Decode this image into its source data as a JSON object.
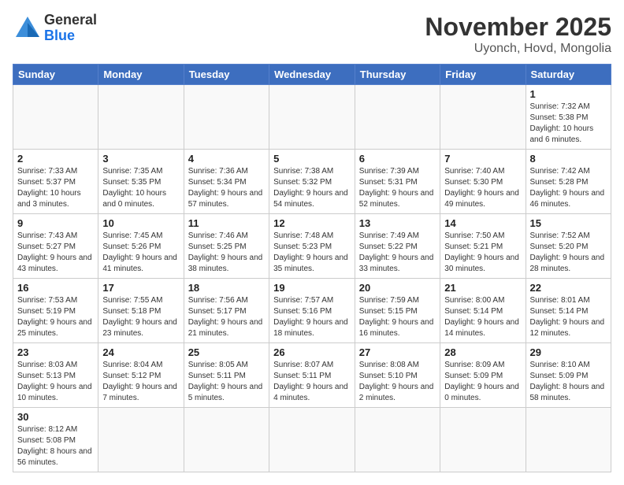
{
  "header": {
    "logo_general": "General",
    "logo_blue": "Blue",
    "month_title": "November 2025",
    "subtitle": "Uyonch, Hovd, Mongolia"
  },
  "days_of_week": [
    "Sunday",
    "Monday",
    "Tuesday",
    "Wednesday",
    "Thursday",
    "Friday",
    "Saturday"
  ],
  "weeks": [
    [
      {
        "day": "",
        "info": ""
      },
      {
        "day": "",
        "info": ""
      },
      {
        "day": "",
        "info": ""
      },
      {
        "day": "",
        "info": ""
      },
      {
        "day": "",
        "info": ""
      },
      {
        "day": "",
        "info": ""
      },
      {
        "day": "1",
        "info": "Sunrise: 7:32 AM\nSunset: 5:38 PM\nDaylight: 10 hours and 6 minutes."
      }
    ],
    [
      {
        "day": "2",
        "info": "Sunrise: 7:33 AM\nSunset: 5:37 PM\nDaylight: 10 hours and 3 minutes."
      },
      {
        "day": "3",
        "info": "Sunrise: 7:35 AM\nSunset: 5:35 PM\nDaylight: 10 hours and 0 minutes."
      },
      {
        "day": "4",
        "info": "Sunrise: 7:36 AM\nSunset: 5:34 PM\nDaylight: 9 hours and 57 minutes."
      },
      {
        "day": "5",
        "info": "Sunrise: 7:38 AM\nSunset: 5:32 PM\nDaylight: 9 hours and 54 minutes."
      },
      {
        "day": "6",
        "info": "Sunrise: 7:39 AM\nSunset: 5:31 PM\nDaylight: 9 hours and 52 minutes."
      },
      {
        "day": "7",
        "info": "Sunrise: 7:40 AM\nSunset: 5:30 PM\nDaylight: 9 hours and 49 minutes."
      },
      {
        "day": "8",
        "info": "Sunrise: 7:42 AM\nSunset: 5:28 PM\nDaylight: 9 hours and 46 minutes."
      }
    ],
    [
      {
        "day": "9",
        "info": "Sunrise: 7:43 AM\nSunset: 5:27 PM\nDaylight: 9 hours and 43 minutes."
      },
      {
        "day": "10",
        "info": "Sunrise: 7:45 AM\nSunset: 5:26 PM\nDaylight: 9 hours and 41 minutes."
      },
      {
        "day": "11",
        "info": "Sunrise: 7:46 AM\nSunset: 5:25 PM\nDaylight: 9 hours and 38 minutes."
      },
      {
        "day": "12",
        "info": "Sunrise: 7:48 AM\nSunset: 5:23 PM\nDaylight: 9 hours and 35 minutes."
      },
      {
        "day": "13",
        "info": "Sunrise: 7:49 AM\nSunset: 5:22 PM\nDaylight: 9 hours and 33 minutes."
      },
      {
        "day": "14",
        "info": "Sunrise: 7:50 AM\nSunset: 5:21 PM\nDaylight: 9 hours and 30 minutes."
      },
      {
        "day": "15",
        "info": "Sunrise: 7:52 AM\nSunset: 5:20 PM\nDaylight: 9 hours and 28 minutes."
      }
    ],
    [
      {
        "day": "16",
        "info": "Sunrise: 7:53 AM\nSunset: 5:19 PM\nDaylight: 9 hours and 25 minutes."
      },
      {
        "day": "17",
        "info": "Sunrise: 7:55 AM\nSunset: 5:18 PM\nDaylight: 9 hours and 23 minutes."
      },
      {
        "day": "18",
        "info": "Sunrise: 7:56 AM\nSunset: 5:17 PM\nDaylight: 9 hours and 21 minutes."
      },
      {
        "day": "19",
        "info": "Sunrise: 7:57 AM\nSunset: 5:16 PM\nDaylight: 9 hours and 18 minutes."
      },
      {
        "day": "20",
        "info": "Sunrise: 7:59 AM\nSunset: 5:15 PM\nDaylight: 9 hours and 16 minutes."
      },
      {
        "day": "21",
        "info": "Sunrise: 8:00 AM\nSunset: 5:14 PM\nDaylight: 9 hours and 14 minutes."
      },
      {
        "day": "22",
        "info": "Sunrise: 8:01 AM\nSunset: 5:14 PM\nDaylight: 9 hours and 12 minutes."
      }
    ],
    [
      {
        "day": "23",
        "info": "Sunrise: 8:03 AM\nSunset: 5:13 PM\nDaylight: 9 hours and 10 minutes."
      },
      {
        "day": "24",
        "info": "Sunrise: 8:04 AM\nSunset: 5:12 PM\nDaylight: 9 hours and 7 minutes."
      },
      {
        "day": "25",
        "info": "Sunrise: 8:05 AM\nSunset: 5:11 PM\nDaylight: 9 hours and 5 minutes."
      },
      {
        "day": "26",
        "info": "Sunrise: 8:07 AM\nSunset: 5:11 PM\nDaylight: 9 hours and 4 minutes."
      },
      {
        "day": "27",
        "info": "Sunrise: 8:08 AM\nSunset: 5:10 PM\nDaylight: 9 hours and 2 minutes."
      },
      {
        "day": "28",
        "info": "Sunrise: 8:09 AM\nSunset: 5:09 PM\nDaylight: 9 hours and 0 minutes."
      },
      {
        "day": "29",
        "info": "Sunrise: 8:10 AM\nSunset: 5:09 PM\nDaylight: 8 hours and 58 minutes."
      }
    ],
    [
      {
        "day": "30",
        "info": "Sunrise: 8:12 AM\nSunset: 5:08 PM\nDaylight: 8 hours and 56 minutes."
      },
      {
        "day": "",
        "info": ""
      },
      {
        "day": "",
        "info": ""
      },
      {
        "day": "",
        "info": ""
      },
      {
        "day": "",
        "info": ""
      },
      {
        "day": "",
        "info": ""
      },
      {
        "day": "",
        "info": ""
      }
    ]
  ]
}
